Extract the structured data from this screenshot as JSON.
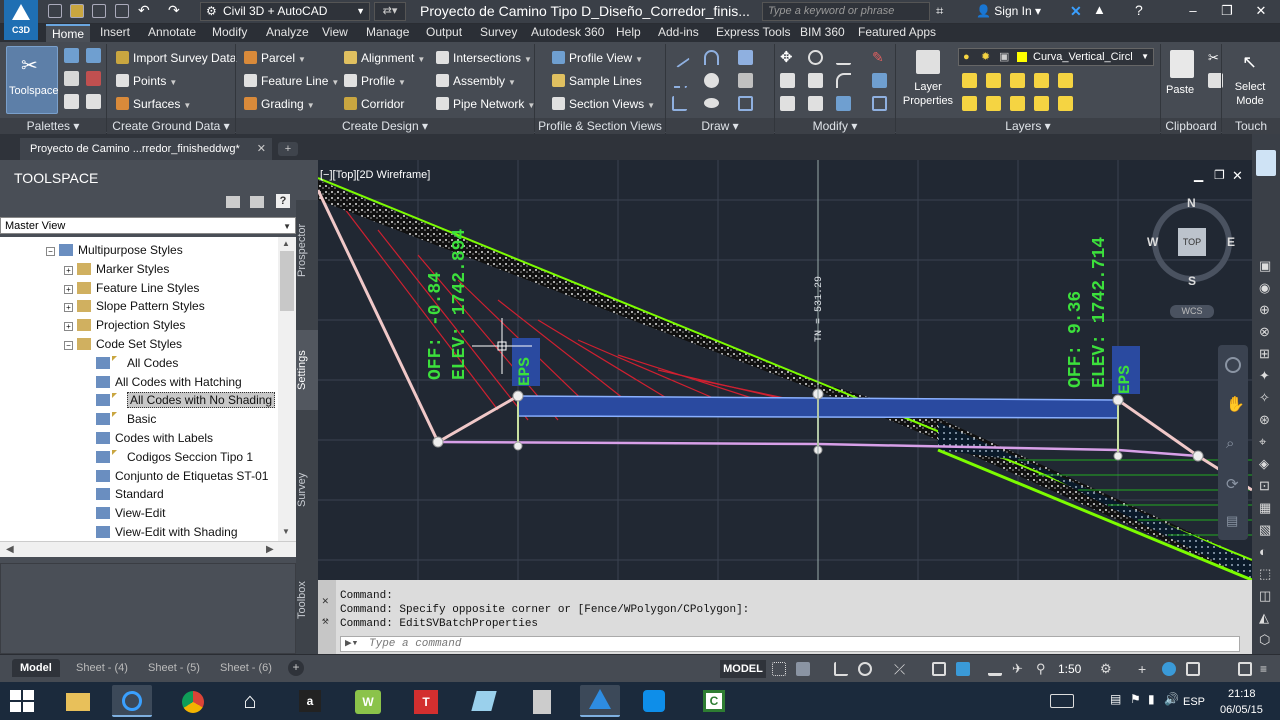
{
  "title_bar": {
    "workspace": "Civil 3D + AutoCAD",
    "document_title": "Proyecto de Camino Tipo D_Diseño_Corredor_finis...",
    "search_placeholder": "Type a keyword or phrase",
    "sign_in": "Sign In",
    "app_badge": "C3D"
  },
  "ribbon_tabs": [
    "Home",
    "Insert",
    "Annotate",
    "Modify",
    "Analyze",
    "View",
    "Manage",
    "Output",
    "Survey",
    "Autodesk 360",
    "Help",
    "Add-ins",
    "Express Tools",
    "BIM 360",
    "Featured Apps"
  ],
  "ribbon": {
    "toolspace": "Toolspace",
    "import_survey": "Import Survey Data",
    "points": "Points",
    "surfaces": "Surfaces",
    "parcel": "Parcel",
    "feature_line": "Feature Line",
    "grading": "Grading",
    "alignment": "Alignment",
    "profile": "Profile",
    "corridor": "Corridor",
    "intersections": "Intersections",
    "assembly": "Assembly",
    "pipe_network": "Pipe Network",
    "profile_view": "Profile View",
    "sample_lines": "Sample Lines",
    "section_views": "Section Views",
    "layer_properties": "Layer Properties",
    "layer_name": "Curva_Vertical_Circl",
    "paste": "Paste",
    "select_mode": "Select Mode",
    "panels": {
      "palettes": "Palettes",
      "create_ground": "Create Ground Data",
      "create_design": "Create Design",
      "profile_section": "Profile & Section Views",
      "draw": "Draw",
      "modify": "Modify",
      "layers": "Layers",
      "clipboard": "Clipboard",
      "touch": "Touch"
    }
  },
  "doc_tab": "Proyecto de Camino ...rredor_finisheddwg*",
  "toolspace": {
    "title": "TOOLSPACE",
    "view": "Master View",
    "tree": [
      {
        "label": "Multipurpose Styles",
        "level": 0,
        "expand": "−"
      },
      {
        "label": "Marker Styles",
        "level": 1,
        "expand": "+"
      },
      {
        "label": "Feature Line Styles",
        "level": 1,
        "expand": "+"
      },
      {
        "label": "Slope Pattern Styles",
        "level": 1,
        "expand": "+"
      },
      {
        "label": "Projection Styles",
        "level": 1,
        "expand": "+"
      },
      {
        "label": "Code Set Styles",
        "level": 1,
        "expand": "−"
      },
      {
        "label": "All Codes",
        "level": 2,
        "flag": true
      },
      {
        "label": "All Codes with Hatching",
        "level": 2,
        "flag": false
      },
      {
        "label": "All Codes with No Shading",
        "level": 2,
        "flag": true,
        "selected": true
      },
      {
        "label": "Basic",
        "level": 2,
        "flag": true
      },
      {
        "label": "Codes with Labels",
        "level": 2,
        "flag": false
      },
      {
        "label": "Codigos Seccion Tipo 1",
        "level": 2,
        "flag": true
      },
      {
        "label": "Conjunto de Etiquetas ST-01",
        "level": 2,
        "flag": false
      },
      {
        "label": "Standard",
        "level": 2,
        "flag": false
      },
      {
        "label": "View-Edit",
        "level": 2,
        "flag": false
      },
      {
        "label": "View-Edit with Shading",
        "level": 2,
        "flag": false
      }
    ],
    "side_tabs": [
      "Prospector",
      "Settings",
      "Survey",
      "Toolbox"
    ]
  },
  "viewport": {
    "label": "[−][Top][2D Wireframe]",
    "compass": {
      "n": "N",
      "s": "S",
      "e": "E",
      "w": "W",
      "top": "TOP",
      "wcs": "WCS"
    },
    "label_left_off": "OFF: -0.84",
    "label_left_elev": "ELEV: 1742.894",
    "label_left_eps": "EPS",
    "label_center": "TN = 531.29",
    "label_right_off": "OFF: 9.36",
    "label_right_elev": "ELEV: 1742.714",
    "label_right_eps": "EPS"
  },
  "command": {
    "lines": [
      "Command:",
      "Command: Specify opposite corner or [Fence/WPolygon/CPolygon]:",
      "Command: EditSVBatchProperties"
    ],
    "placeholder": "Type a command"
  },
  "status": {
    "tabs": [
      "Model",
      "Sheet - (4)",
      "Sheet - (5)",
      "Sheet - (6)"
    ],
    "model": "MODEL",
    "scale": "1:50"
  },
  "taskbar": {
    "lang": "ESP",
    "time": "21:18",
    "date": "06/05/15"
  }
}
